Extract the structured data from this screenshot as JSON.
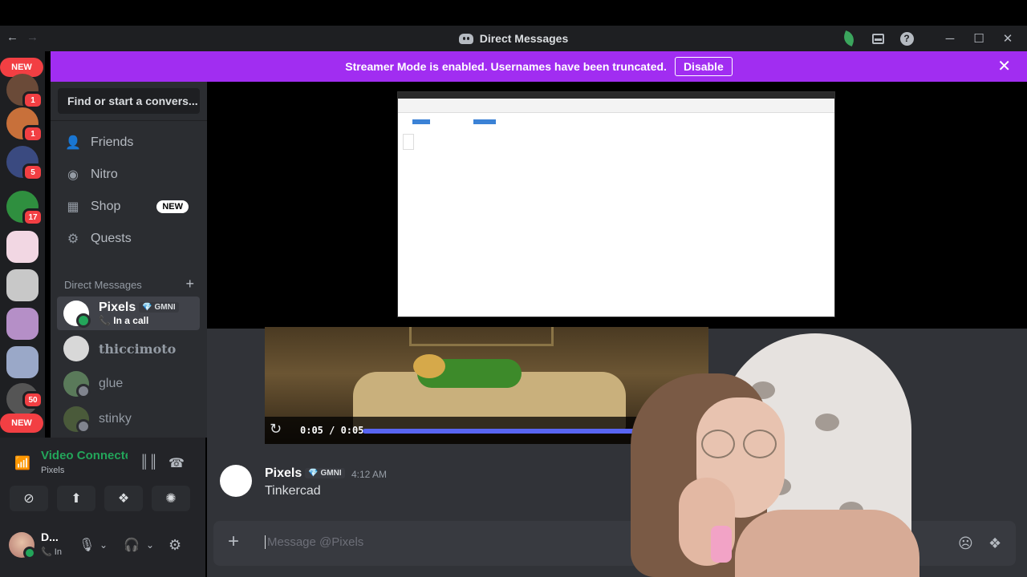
{
  "titlebar": {
    "title": "Direct Messages",
    "back": "←",
    "forward": "→",
    "min": "─",
    "max": "☐",
    "close": "✕"
  },
  "banner": {
    "text": "Streamer Mode is enabled. Usernames have been truncated.",
    "button": "Disable",
    "close": "✕"
  },
  "guilds": [
    {
      "badge": "1",
      "color": "#7a4a30"
    },
    {
      "badge": "1",
      "color": "#c8703a"
    },
    {
      "badge": "5",
      "color": "#3a4a80"
    },
    {
      "badge": "17",
      "color": "#2f8f3f"
    },
    {
      "badge": "",
      "color": "#f2d7e3"
    },
    {
      "badge": "",
      "color": "#c8c8c8"
    },
    {
      "badge": "",
      "color": "#b58fc7"
    },
    {
      "badge": "",
      "color": "#9aa8c8"
    },
    {
      "badge": "50",
      "color": "#555"
    }
  ],
  "guild_new": "NEW",
  "sidebar": {
    "search": "Find or start a convers...",
    "nav": [
      {
        "label": "Friends",
        "icon": "friends-icon"
      },
      {
        "label": "Nitro",
        "icon": "nitro-icon"
      },
      {
        "label": "Shop",
        "icon": "shop-icon",
        "tag": "NEW"
      },
      {
        "label": "Quests",
        "icon": "quests-icon"
      }
    ],
    "dm_header": "Direct Messages",
    "dm_add": "+",
    "dms": [
      {
        "name": "Pixels",
        "tag": "💎 GMNI",
        "status": "In a call",
        "active": true
      },
      {
        "name": "thiccimoto"
      },
      {
        "name": "glue"
      },
      {
        "name": "stinky"
      }
    ]
  },
  "voice": {
    "title": "Video Connected",
    "sub": "Pixels"
  },
  "user": {
    "name": "D...",
    "status": "In"
  },
  "video": {
    "time": "0:05 / 0:05",
    "progress": 1.0
  },
  "message": {
    "author": "Pixels",
    "tag": "💎 GMNI",
    "time": "4:12 AM",
    "text": "Tinkercad"
  },
  "composer": {
    "placeholder": "Message @Pixels"
  }
}
